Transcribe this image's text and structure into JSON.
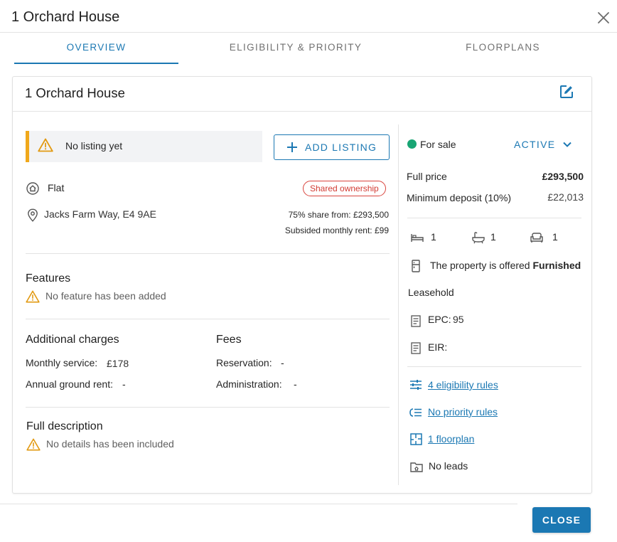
{
  "dialog": {
    "title": "1 Orchard House",
    "close_icon": "close-icon"
  },
  "tabs": [
    {
      "label": "OVERVIEW",
      "active": true
    },
    {
      "label": "ELIGIBILITY & PRIORITY",
      "active": false
    },
    {
      "label": "FLOORPLANS",
      "active": false
    }
  ],
  "card": {
    "title": "1 Orchard House",
    "edit_icon": "edit-icon"
  },
  "listing": {
    "message": "No listing yet",
    "add_label": "ADD LISTING"
  },
  "property": {
    "type": "Flat",
    "badge": "Shared ownership",
    "address": "Jacks Farm Way, E4 9AE",
    "share_from": "75% share from: £293,500",
    "monthly_rent": "Subsided monthly rent: £99"
  },
  "features": {
    "heading": "Features",
    "empty": "No feature has been added"
  },
  "additional_charges": {
    "heading": "Additional charges",
    "monthly_service_label": "Monthly service:",
    "monthly_service_value": "£178",
    "ground_rent_label": "Annual ground rent:",
    "ground_rent_value": "-"
  },
  "fees": {
    "heading": "Fees",
    "reservation_label": "Reservation:",
    "reservation_value": "-",
    "administration_label": "Administration:",
    "administration_value": "-"
  },
  "description": {
    "heading": "Full description",
    "empty": "No details has been included"
  },
  "sale": {
    "status": "For sale",
    "state": "ACTIVE",
    "status_color": "#18a574",
    "full_price_label": "Full price",
    "full_price_value": "£293,500",
    "deposit_label": "Minimum deposit (10%)",
    "deposit_value": "£22,013"
  },
  "rooms": {
    "bedrooms": "1",
    "bathrooms": "1",
    "living_rooms": "1"
  },
  "furnishing": {
    "prefix": "The property is offered",
    "value": "Furnished"
  },
  "tenure": "Leasehold",
  "epc": {
    "label": "EPC:",
    "value": "95"
  },
  "eir": {
    "label": "EIR:",
    "value": ""
  },
  "links": {
    "eligibility": "4 eligibility rules",
    "priority": "No priority rules",
    "floorplan": "1 floorplan",
    "leads": "No leads"
  },
  "footer": {
    "close_label": "CLOSE"
  },
  "colors": {
    "accent": "#1b78b3",
    "warning": "#f0a81b",
    "badge": "#d9443d"
  }
}
